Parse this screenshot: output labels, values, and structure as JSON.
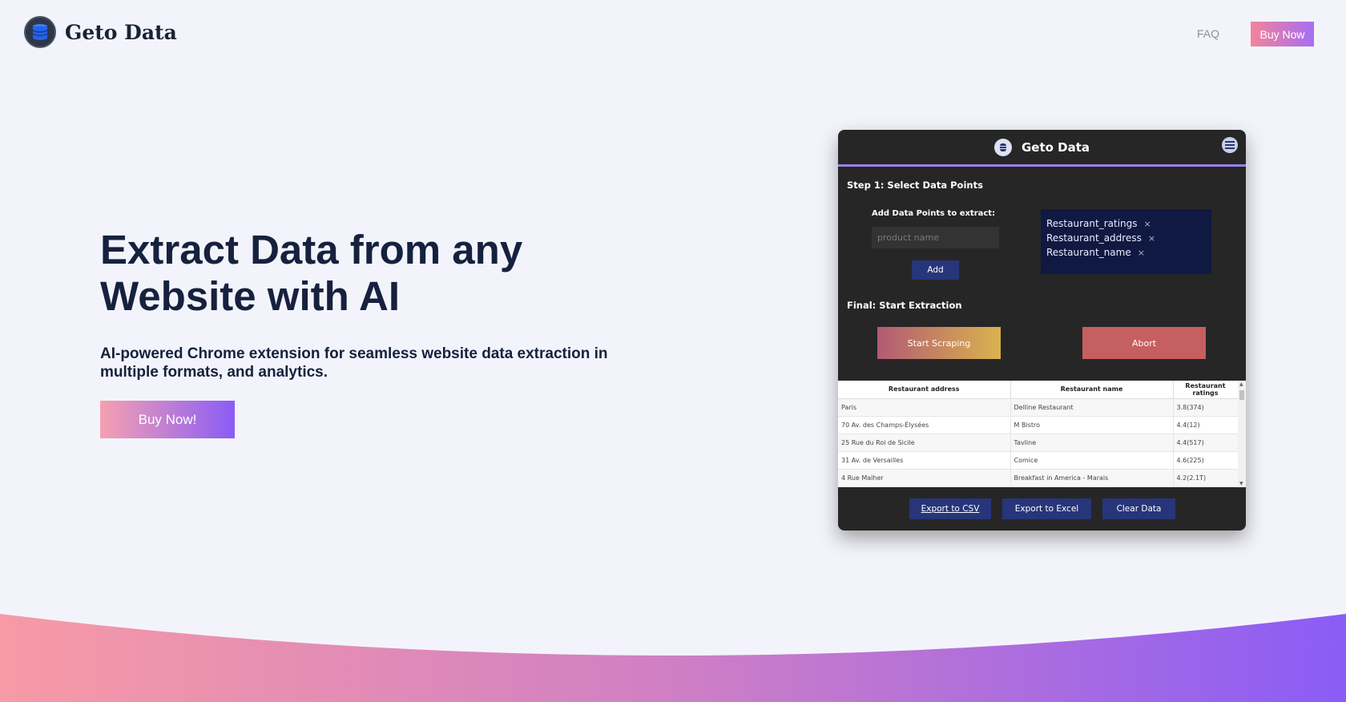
{
  "brand": {
    "name": "Geto Data"
  },
  "nav": {
    "faq": "FAQ",
    "buy": "Buy Now"
  },
  "hero": {
    "title": "Extract Data from any Website with AI",
    "subtitle": "AI-powered Chrome extension for seamless website data extraction in multiple formats, and analytics.",
    "cta": "Buy Now!"
  },
  "colors": {
    "accent_start": "#f5839a",
    "accent_end": "#8a5cf6",
    "popup_bg": "#262626",
    "popup_button": "#27357a"
  },
  "popup": {
    "title": "Geto Data",
    "step1": "Step 1: Select Data Points",
    "add_label": "Add Data Points to extract:",
    "input_placeholder": "product name",
    "add_button": "Add",
    "data_points": [
      "Restaurant_ratings",
      "Restaurant_address",
      "Restaurant_name"
    ],
    "chip_remove": "×",
    "final": "Final: Start Extraction",
    "start_button": "Start Scraping",
    "abort_button": "Abort",
    "table": {
      "headers": [
        "Restaurant address",
        "Restaurant name",
        "Restaurant ratings"
      ],
      "rows": [
        [
          "Paris",
          "Delline Restaurant",
          "3.8(374)"
        ],
        [
          "70 Av. des Champs-Élysées",
          "M Bistro",
          "4.4(12)"
        ],
        [
          "25 Rue du Roi de Sicile",
          "Tavline",
          "4.4(517)"
        ],
        [
          "31 Av. de Versailles",
          "Comice",
          "4.6(225)"
        ],
        [
          "4 Rue Malher",
          "Breakfast in America - Marais",
          "4.2(2.1T)"
        ]
      ]
    },
    "export_csv": "Export to CSV",
    "export_excel": "Export to Excel",
    "clear_data": "Clear Data"
  }
}
